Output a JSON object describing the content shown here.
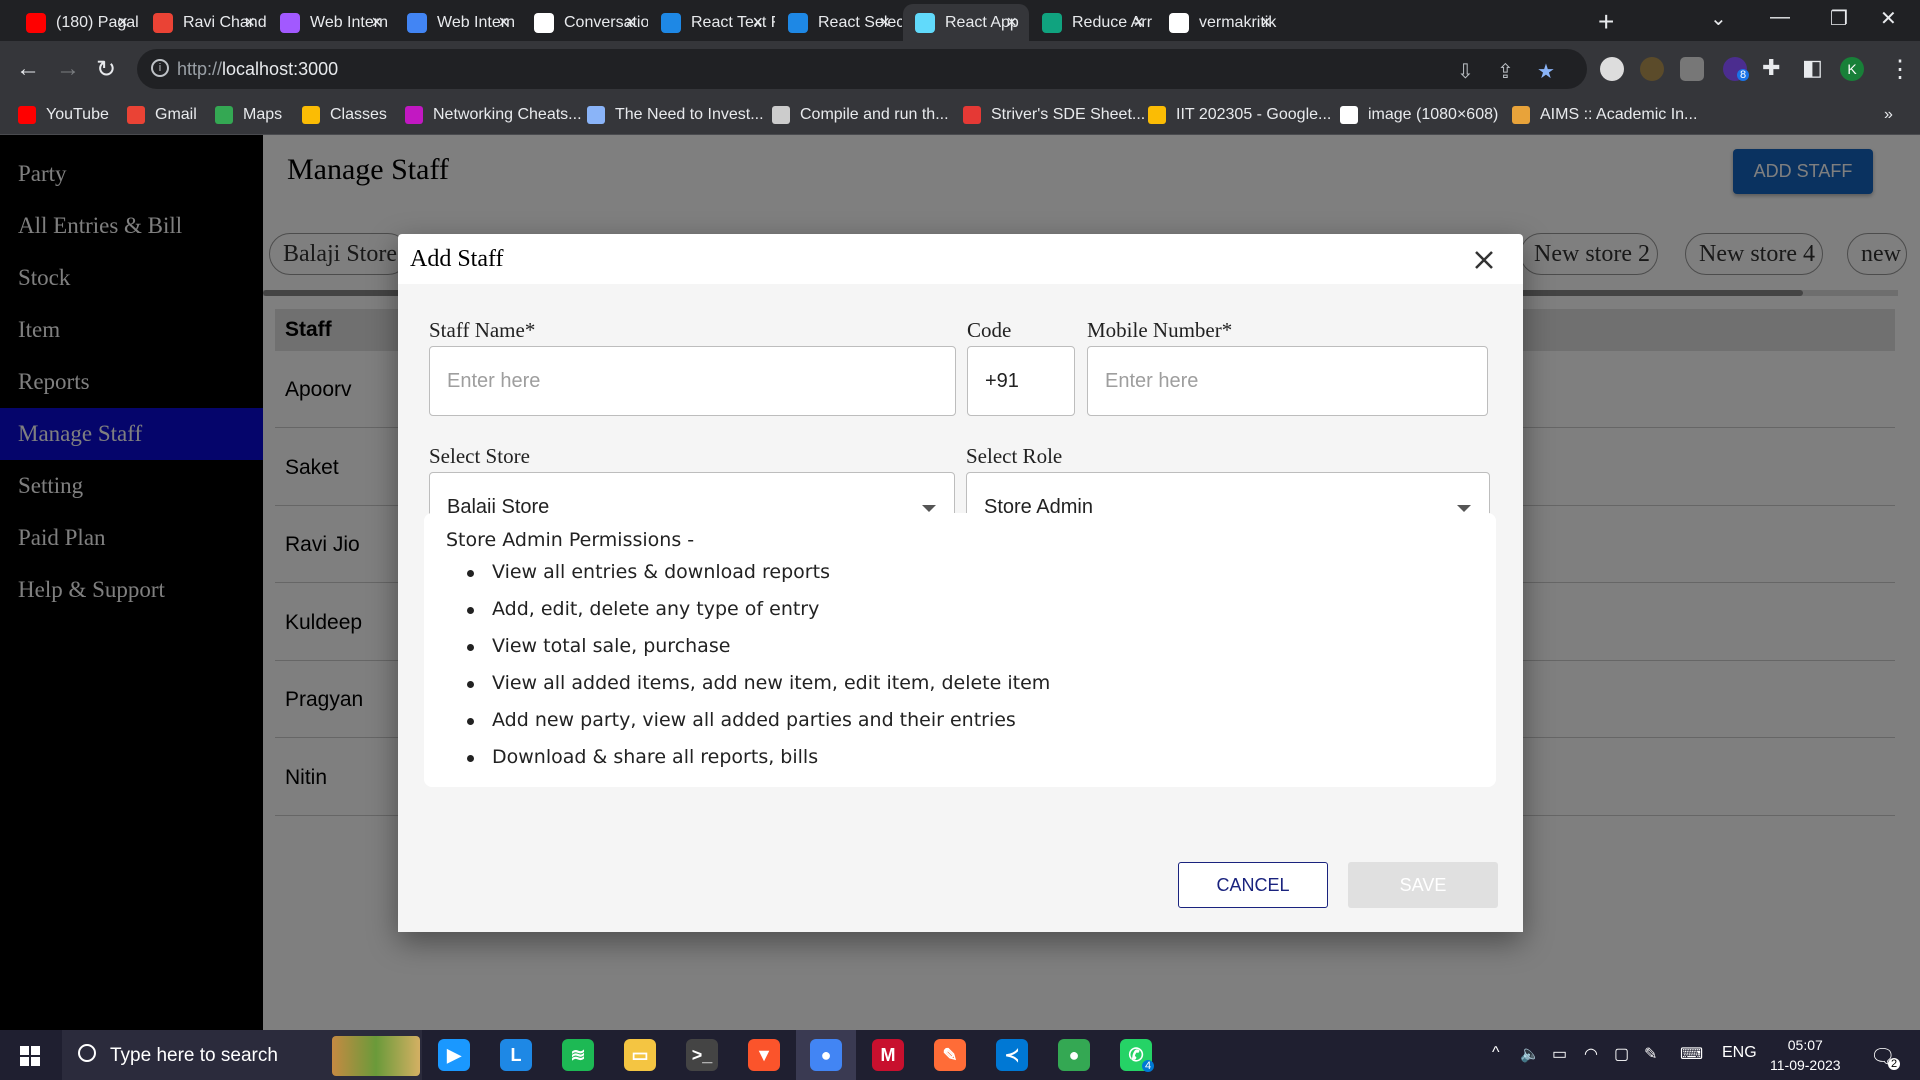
{
  "browser": {
    "tabs": [
      {
        "label": "(180) Pagal",
        "icon": "youtube-icon",
        "color": "#ff0000"
      },
      {
        "label": "Ravi Chand",
        "icon": "gmail-icon",
        "color": "#ea4335"
      },
      {
        "label": "Web Intern",
        "icon": "figma-icon",
        "color": "#a259ff"
      },
      {
        "label": "Web Intern",
        "icon": "google-docs-icon",
        "color": "#4285f4"
      },
      {
        "label": "Conversatio",
        "icon": "webflow-icon",
        "color": "#ffffff"
      },
      {
        "label": "React Text F",
        "icon": "mui-icon",
        "color": "#1e88e5"
      },
      {
        "label": "React Selec",
        "icon": "mui-icon",
        "color": "#1e88e5"
      },
      {
        "label": "React App",
        "icon": "react-icon",
        "color": "#61dafb"
      },
      {
        "label": "Reduce Arr",
        "icon": "openai-icon",
        "color": "#10a37f"
      },
      {
        "label": "vermakritik",
        "icon": "github-icon",
        "color": "#ffffff"
      }
    ],
    "url_host": "http://",
    "url_path": "localhost:3000",
    "profile_initial": "K",
    "extension_badge": "8",
    "bookmarks": [
      {
        "label": "YouTube",
        "color": "#ff0000"
      },
      {
        "label": "Gmail",
        "color": "#ea4335"
      },
      {
        "label": "Maps",
        "color": "#34a853"
      },
      {
        "label": "Classes",
        "color": "#fbbc04"
      },
      {
        "label": "Networking Cheats...",
        "color": "#c218c2"
      },
      {
        "label": "The Need to Invest...",
        "color": "#8ab4f8"
      },
      {
        "label": "Compile and run th...",
        "color": "#cccccc"
      },
      {
        "label": "Striver's SDE Sheet...",
        "color": "#e53935"
      },
      {
        "label": "IIT 202305 - Google...",
        "color": "#fbbc04"
      },
      {
        "label": "image (1080×608)",
        "color": "#ffffff"
      },
      {
        "label": "AIMS :: Academic In...",
        "color": "#e8a33a"
      }
    ],
    "more_bookmarks": "»"
  },
  "sidebar": {
    "items": [
      {
        "label": "Party"
      },
      {
        "label": "All Entries & Bill"
      },
      {
        "label": "Stock"
      },
      {
        "label": "Item"
      },
      {
        "label": "Reports"
      },
      {
        "label": "Manage Staff",
        "active": true
      },
      {
        "label": "Setting"
      },
      {
        "label": "Paid Plan"
      },
      {
        "label": "Help & Support"
      }
    ]
  },
  "main": {
    "title": "Manage Staff",
    "add_button": "ADD STAFF",
    "stores": [
      "Balaji Store",
      "New store 2",
      "New store 4",
      "new"
    ],
    "table_header": "Staff",
    "staff": [
      "Apoorv",
      "Saket",
      "Ravi Jio",
      "Kuldeep",
      "Pragyan",
      "Nitin"
    ]
  },
  "modal": {
    "title": "Add Staff",
    "staff_name_label": "Staff Name*",
    "staff_name_placeholder": "Enter here",
    "code_label": "Code",
    "code_value": "+91",
    "mobile_label": "Mobile Number*",
    "mobile_placeholder": "Enter here",
    "store_label": "Select Store",
    "store_value": "Balaji Store",
    "role_label": "Select Role",
    "role_value": "Store Admin",
    "permissions_title": "Store Admin Permissions -",
    "permissions": [
      "View all entries & download reports",
      "Add, edit, delete any type of entry",
      "View total sale, purchase",
      "View all added items, add new item, edit item, delete item",
      "Add new party, view all added parties and their entries",
      "Download & share all reports, bills"
    ],
    "cancel_label": "CANCEL",
    "save_label": "SAVE"
  },
  "taskbar": {
    "search_placeholder": "Type here to search",
    "language": "ENG",
    "time": "05:07",
    "date": "11-09-2023",
    "whatsapp_badge": "4",
    "notification_badge": "2",
    "apps": [
      {
        "name": "prime-video-icon",
        "color": "#1a98ff",
        "glyph": "▶"
      },
      {
        "name": "l-app-icon",
        "color": "#1e88e5",
        "glyph": "L"
      },
      {
        "name": "spotify-icon",
        "color": "#1db954",
        "glyph": "≋"
      },
      {
        "name": "file-explorer-icon",
        "color": "#f4c542",
        "glyph": "▭"
      },
      {
        "name": "terminal-icon",
        "color": "#444444",
        "glyph": ">_"
      },
      {
        "name": "brave-icon",
        "color": "#fb542b",
        "glyph": "▼"
      },
      {
        "name": "chrome-icon",
        "color": "#4285f4",
        "glyph": "●"
      },
      {
        "name": "mcafee-icon",
        "color": "#c8102e",
        "glyph": "M"
      },
      {
        "name": "postman-icon",
        "color": "#ff6c37",
        "glyph": "✎"
      },
      {
        "name": "vscode-icon",
        "color": "#0078d4",
        "glyph": "≺"
      },
      {
        "name": "chrome-profile-icon",
        "color": "#34a853",
        "glyph": "●"
      },
      {
        "name": "whatsapp-icon",
        "color": "#25d366",
        "glyph": "✆"
      }
    ]
  },
  "colors": {
    "sidebar_active": "#0a0ad6",
    "primary_button": "#1565c0",
    "cancel_border": "#1a237e"
  }
}
